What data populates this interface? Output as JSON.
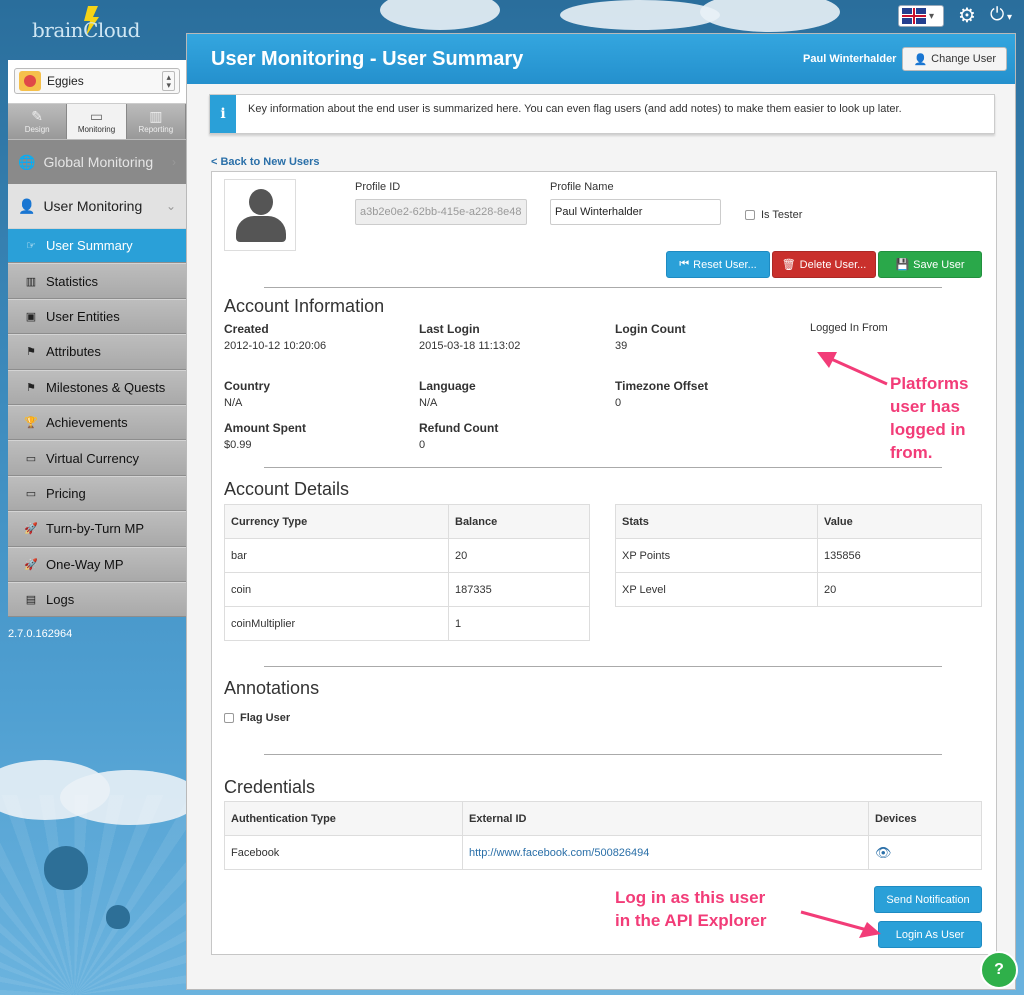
{
  "brand": {
    "logo_text": "brainCloud"
  },
  "topbar": {
    "language": "English (UK)",
    "settings_icon": "gear-icon",
    "power_icon": "power-icon"
  },
  "sidebar": {
    "app_name": "Eggies",
    "modes": [
      {
        "label": "Design",
        "icon": "pencil-icon"
      },
      {
        "label": "Monitoring",
        "icon": "monitor-icon"
      },
      {
        "label": "Reporting",
        "icon": "chart-icon"
      }
    ],
    "sections": {
      "global": "Global Monitoring",
      "user": "User Monitoring"
    },
    "items": [
      {
        "label": "User Summary",
        "icon": "☞"
      },
      {
        "label": "Statistics",
        "icon": "▥"
      },
      {
        "label": "User Entities",
        "icon": "▣"
      },
      {
        "label": "Attributes",
        "icon": "⚑"
      },
      {
        "label": "Milestones & Quests",
        "icon": "⚑"
      },
      {
        "label": "Achievements",
        "icon": "🏆"
      },
      {
        "label": "Virtual Currency",
        "icon": "▭"
      },
      {
        "label": "Pricing",
        "icon": "▭"
      },
      {
        "label": "Turn-by-Turn MP",
        "icon": "🚀"
      },
      {
        "label": "One-Way MP",
        "icon": "🚀"
      },
      {
        "label": "Logs",
        "icon": "▤"
      }
    ],
    "version": "2.7.0.162964"
  },
  "header": {
    "title": "User Monitoring - User Summary",
    "user_name": "Paul Winterhalder",
    "change_user": "Change User"
  },
  "info": {
    "icon": "i",
    "text": "Key information about the end user is summarized here. You can even flag users (and add notes) to make them easier to look up later."
  },
  "back_link": "< Back to New Users",
  "profile": {
    "id_label": "Profile ID",
    "id_value": "a3b2e0e2-62bb-415e-a228-8e48",
    "name_label": "Profile Name",
    "name_value": "Paul Winterhalder",
    "tester_label": "Is Tester"
  },
  "actions": {
    "reset": "Reset User...",
    "delete": "Delete User...",
    "save": "Save User"
  },
  "account_info": {
    "title": "Account Information",
    "created_label": "Created",
    "created": "2012-10-12 10:20:06",
    "last_login_label": "Last Login",
    "last_login": "2015-03-18 11:13:02",
    "login_count_label": "Login Count",
    "login_count": "39",
    "logged_in_from_label": "Logged In From",
    "country_label": "Country",
    "country": "N/A",
    "language_label": "Language",
    "language": "N/A",
    "timezone_label": "Timezone Offset",
    "timezone": "0",
    "amount_spent_label": "Amount Spent",
    "amount_spent": "$0.99",
    "refund_count_label": "Refund Count",
    "refund_count": "0"
  },
  "account_details": {
    "title": "Account Details",
    "currency_headers": [
      "Currency Type",
      "Balance"
    ],
    "currencies": [
      [
        "bar",
        "20"
      ],
      [
        "coin",
        "187335"
      ],
      [
        "coinMultiplier",
        "1"
      ]
    ],
    "stats_headers": [
      "Stats",
      "Value"
    ],
    "stats": [
      [
        "XP Points",
        "135856"
      ],
      [
        "XP Level",
        "20"
      ]
    ]
  },
  "annotations": {
    "title": "Annotations",
    "flag_label": "Flag User"
  },
  "credentials": {
    "title": "Credentials",
    "headers": [
      "Authentication Type",
      "External ID",
      "Devices"
    ],
    "rows": [
      [
        "Facebook",
        "http://www.facebook.com/500826494"
      ]
    ]
  },
  "bottom_actions": {
    "send_notification": "Send Notification",
    "login_as_user": "Login As User"
  },
  "callouts": {
    "platforms": [
      "Platforms",
      "user has",
      "logged in",
      "from."
    ],
    "login": [
      "Log in as this user",
      "in the API Explorer"
    ]
  },
  "help": "?"
}
